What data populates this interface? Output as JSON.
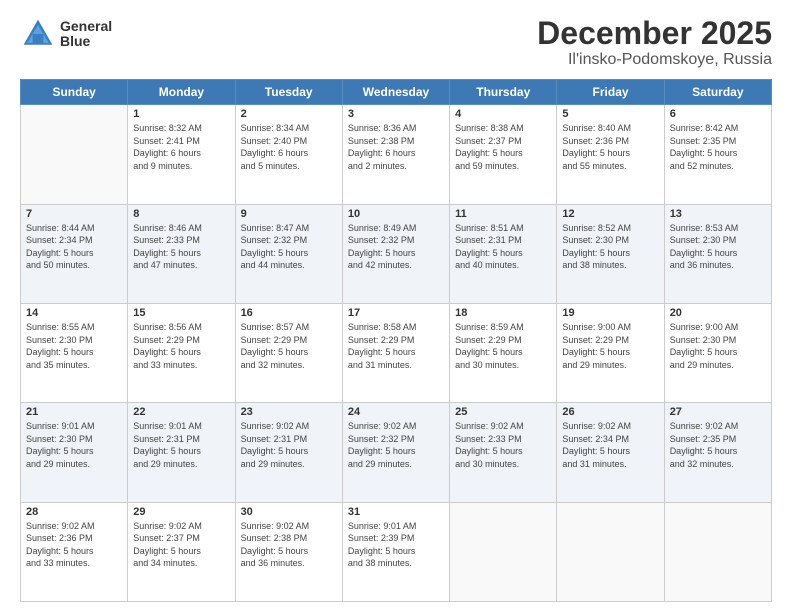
{
  "header": {
    "logo_line1": "General",
    "logo_line2": "Blue",
    "month": "December 2025",
    "location": "Il'insko-Podomskoye, Russia"
  },
  "weekdays": [
    "Sunday",
    "Monday",
    "Tuesday",
    "Wednesday",
    "Thursday",
    "Friday",
    "Saturday"
  ],
  "weeks": [
    [
      {
        "day": "",
        "info": ""
      },
      {
        "day": "1",
        "info": "Sunrise: 8:32 AM\nSunset: 2:41 PM\nDaylight: 6 hours\nand 9 minutes."
      },
      {
        "day": "2",
        "info": "Sunrise: 8:34 AM\nSunset: 2:40 PM\nDaylight: 6 hours\nand 5 minutes."
      },
      {
        "day": "3",
        "info": "Sunrise: 8:36 AM\nSunset: 2:38 PM\nDaylight: 6 hours\nand 2 minutes."
      },
      {
        "day": "4",
        "info": "Sunrise: 8:38 AM\nSunset: 2:37 PM\nDaylight: 5 hours\nand 59 minutes."
      },
      {
        "day": "5",
        "info": "Sunrise: 8:40 AM\nSunset: 2:36 PM\nDaylight: 5 hours\nand 55 minutes."
      },
      {
        "day": "6",
        "info": "Sunrise: 8:42 AM\nSunset: 2:35 PM\nDaylight: 5 hours\nand 52 minutes."
      }
    ],
    [
      {
        "day": "7",
        "info": "Sunrise: 8:44 AM\nSunset: 2:34 PM\nDaylight: 5 hours\nand 50 minutes."
      },
      {
        "day": "8",
        "info": "Sunrise: 8:46 AM\nSunset: 2:33 PM\nDaylight: 5 hours\nand 47 minutes."
      },
      {
        "day": "9",
        "info": "Sunrise: 8:47 AM\nSunset: 2:32 PM\nDaylight: 5 hours\nand 44 minutes."
      },
      {
        "day": "10",
        "info": "Sunrise: 8:49 AM\nSunset: 2:32 PM\nDaylight: 5 hours\nand 42 minutes."
      },
      {
        "day": "11",
        "info": "Sunrise: 8:51 AM\nSunset: 2:31 PM\nDaylight: 5 hours\nand 40 minutes."
      },
      {
        "day": "12",
        "info": "Sunrise: 8:52 AM\nSunset: 2:30 PM\nDaylight: 5 hours\nand 38 minutes."
      },
      {
        "day": "13",
        "info": "Sunrise: 8:53 AM\nSunset: 2:30 PM\nDaylight: 5 hours\nand 36 minutes."
      }
    ],
    [
      {
        "day": "14",
        "info": "Sunrise: 8:55 AM\nSunset: 2:30 PM\nDaylight: 5 hours\nand 35 minutes."
      },
      {
        "day": "15",
        "info": "Sunrise: 8:56 AM\nSunset: 2:29 PM\nDaylight: 5 hours\nand 33 minutes."
      },
      {
        "day": "16",
        "info": "Sunrise: 8:57 AM\nSunset: 2:29 PM\nDaylight: 5 hours\nand 32 minutes."
      },
      {
        "day": "17",
        "info": "Sunrise: 8:58 AM\nSunset: 2:29 PM\nDaylight: 5 hours\nand 31 minutes."
      },
      {
        "day": "18",
        "info": "Sunrise: 8:59 AM\nSunset: 2:29 PM\nDaylight: 5 hours\nand 30 minutes."
      },
      {
        "day": "19",
        "info": "Sunrise: 9:00 AM\nSunset: 2:29 PM\nDaylight: 5 hours\nand 29 minutes."
      },
      {
        "day": "20",
        "info": "Sunrise: 9:00 AM\nSunset: 2:30 PM\nDaylight: 5 hours\nand 29 minutes."
      }
    ],
    [
      {
        "day": "21",
        "info": "Sunrise: 9:01 AM\nSunset: 2:30 PM\nDaylight: 5 hours\nand 29 minutes."
      },
      {
        "day": "22",
        "info": "Sunrise: 9:01 AM\nSunset: 2:31 PM\nDaylight: 5 hours\nand 29 minutes."
      },
      {
        "day": "23",
        "info": "Sunrise: 9:02 AM\nSunset: 2:31 PM\nDaylight: 5 hours\nand 29 minutes."
      },
      {
        "day": "24",
        "info": "Sunrise: 9:02 AM\nSunset: 2:32 PM\nDaylight: 5 hours\nand 29 minutes."
      },
      {
        "day": "25",
        "info": "Sunrise: 9:02 AM\nSunset: 2:33 PM\nDaylight: 5 hours\nand 30 minutes."
      },
      {
        "day": "26",
        "info": "Sunrise: 9:02 AM\nSunset: 2:34 PM\nDaylight: 5 hours\nand 31 minutes."
      },
      {
        "day": "27",
        "info": "Sunrise: 9:02 AM\nSunset: 2:35 PM\nDaylight: 5 hours\nand 32 minutes."
      }
    ],
    [
      {
        "day": "28",
        "info": "Sunrise: 9:02 AM\nSunset: 2:36 PM\nDaylight: 5 hours\nand 33 minutes."
      },
      {
        "day": "29",
        "info": "Sunrise: 9:02 AM\nSunset: 2:37 PM\nDaylight: 5 hours\nand 34 minutes."
      },
      {
        "day": "30",
        "info": "Sunrise: 9:02 AM\nSunset: 2:38 PM\nDaylight: 5 hours\nand 36 minutes."
      },
      {
        "day": "31",
        "info": "Sunrise: 9:01 AM\nSunset: 2:39 PM\nDaylight: 5 hours\nand 38 minutes."
      },
      {
        "day": "",
        "info": ""
      },
      {
        "day": "",
        "info": ""
      },
      {
        "day": "",
        "info": ""
      }
    ]
  ]
}
